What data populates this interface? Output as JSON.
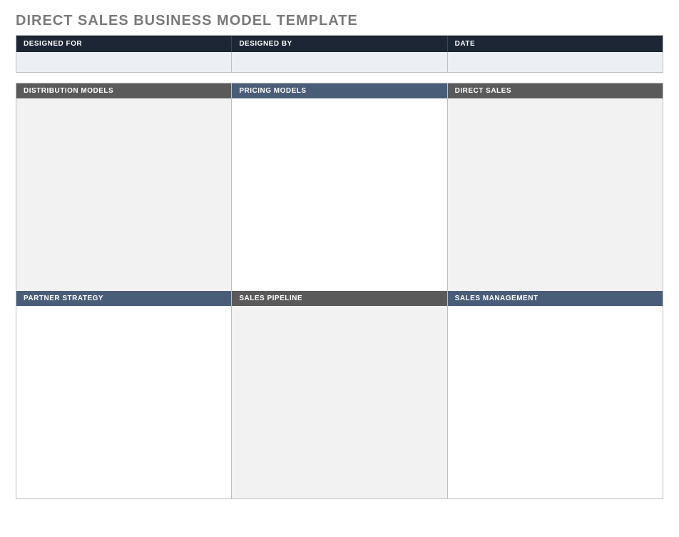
{
  "title": "DIRECT SALES BUSINESS MODEL TEMPLATE",
  "meta": {
    "headers": {
      "designed_for": "DESIGNED FOR",
      "designed_by": "DESIGNED BY",
      "date": "DATE"
    },
    "values": {
      "designed_for": "",
      "designed_by": "",
      "date": ""
    }
  },
  "sections": {
    "row1": {
      "col1": {
        "header": "DISTRIBUTION MODELS",
        "body": ""
      },
      "col2": {
        "header": "PRICING MODELS",
        "body": ""
      },
      "col3": {
        "header": "DIRECT SALES",
        "body": ""
      }
    },
    "row2": {
      "col1": {
        "header": "PARTNER STRATEGY",
        "body": ""
      },
      "col2": {
        "header": "SALES PIPELINE",
        "body": ""
      },
      "col3": {
        "header": "SALES MANAGEMENT",
        "body": ""
      }
    }
  }
}
